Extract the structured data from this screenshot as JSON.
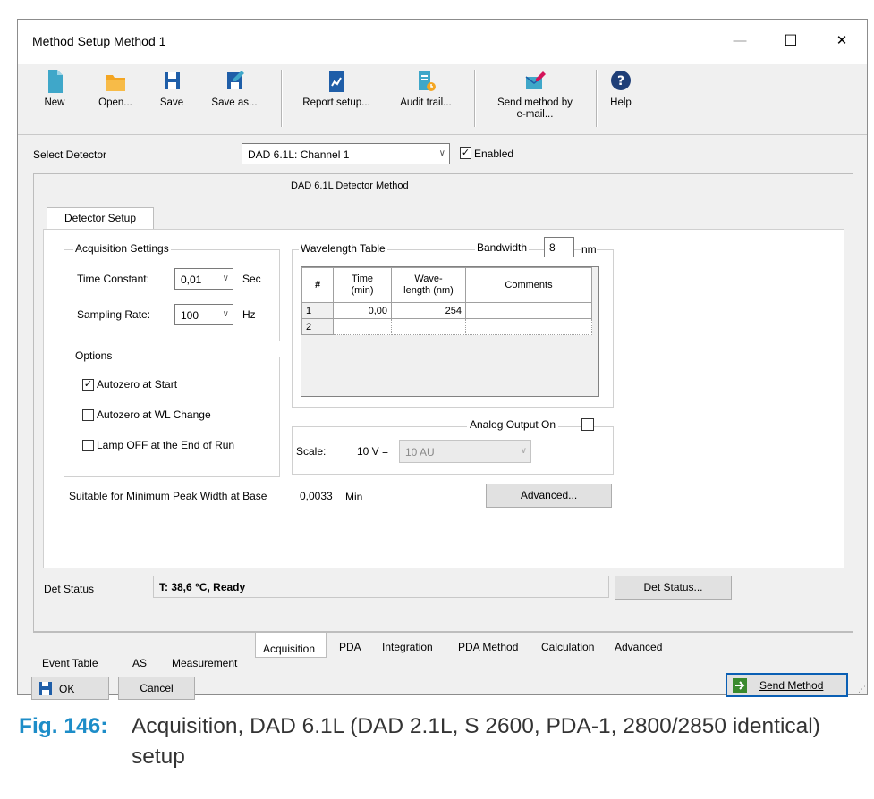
{
  "window": {
    "title": "Method Setup Method 1",
    "minimize": "—",
    "maximize": "☐",
    "close": "✕"
  },
  "toolbar": {
    "new": "New",
    "open": "Open...",
    "save": "Save",
    "save_as": "Save as...",
    "report_setup": "Report setup...",
    "audit_trail": "Audit trail...",
    "send_email_1": "Send method by",
    "send_email_2": "e-mail...",
    "help": "Help"
  },
  "detector": {
    "label": "Select Detector",
    "selected": "DAD 6.1L: Channel 1",
    "enabled_label": "Enabled",
    "enabled": true
  },
  "method_title": "DAD 6.1L Detector Method",
  "setup_tab": "Detector Setup",
  "acq": {
    "title": "Acquisition Settings",
    "time_constant_label": "Time Constant:",
    "time_constant": "0,01",
    "time_unit": "Sec",
    "sampling_label": "Sampling Rate:",
    "sampling": "100",
    "sampling_unit": "Hz"
  },
  "options": {
    "title": "Options",
    "autozero_start": "Autozero at Start",
    "autozero_start_checked": true,
    "autozero_wl": "Autozero at WL Change",
    "autozero_wl_checked": false,
    "lamp_off": "Lamp OFF at the End of Run",
    "lamp_off_checked": false
  },
  "wavelength": {
    "title": "Wavelength Table",
    "bandwidth_label": "Bandwidth",
    "bandwidth": "8",
    "bandwidth_unit": "nm",
    "headers": {
      "num": "#",
      "time1": "Time",
      "time2": "(min)",
      "wave1": "Wave-",
      "wave2": "length (nm)",
      "comments": "Comments"
    },
    "rows": [
      {
        "num": "1",
        "time": "0,00",
        "wave": "254",
        "comment": ""
      },
      {
        "num": "2",
        "time": "",
        "wave": "",
        "comment": ""
      }
    ]
  },
  "analog": {
    "label": "Analog Output On",
    "checked": false,
    "scale_label": "Scale:",
    "scale_v": "10 V =",
    "scale_value": "10 AU"
  },
  "min_peak": {
    "label": "Suitable for Minimum Peak Width at Base",
    "value": "0,0033",
    "unit": "Min"
  },
  "advanced_button": "Advanced...",
  "status": {
    "label": "Det Status",
    "value": "T: 38,6 °C, Ready",
    "button": "Det Status..."
  },
  "tabs": [
    "Event Table",
    "AS",
    "Measurement",
    "Acquisition",
    "PDA",
    "Integration",
    "PDA Method",
    "Calculation",
    "Advanced"
  ],
  "active_tab": "Acquisition",
  "footer": {
    "ok": "OK",
    "cancel": "Cancel",
    "send": "Send Method"
  },
  "caption": {
    "fig": "Fig. 146:",
    "text": "Acquisition, DAD 6.1L (DAD 2.1L, S 2600, PDA-1, 2800/2850 identical) setup"
  },
  "colors": {
    "caption_accent": "#1d8dc8",
    "icon_blue": "#1f5ea8",
    "icon_teal": "#3fa7c9",
    "folder_orange": "#f4a623"
  }
}
